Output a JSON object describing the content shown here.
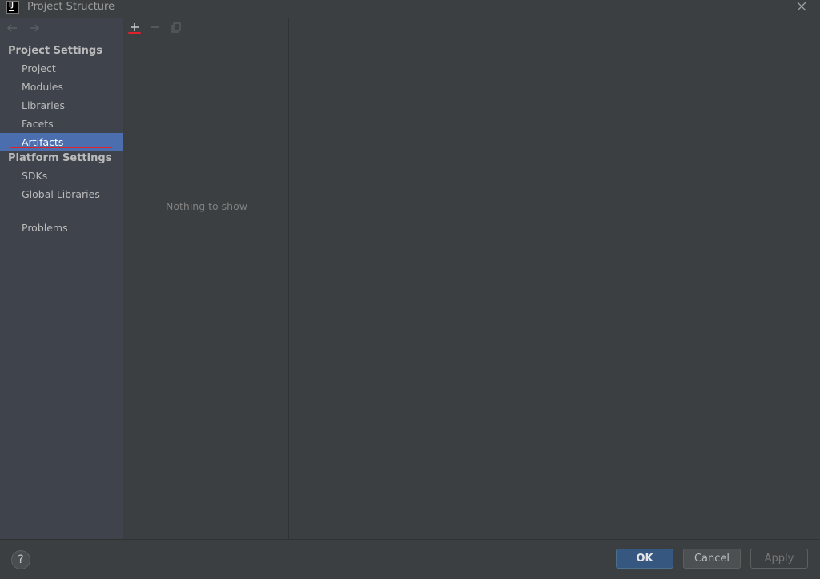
{
  "window": {
    "title": "Project Structure",
    "logo_text": "IJ"
  },
  "sidebar": {
    "project_settings_header": "Project Settings",
    "project_items": [
      "Project",
      "Modules",
      "Libraries",
      "Facets",
      "Artifacts"
    ],
    "platform_settings_header": "Platform Settings",
    "platform_items": [
      "SDKs",
      "Global Libraries"
    ],
    "problems": "Problems",
    "selected": "Artifacts"
  },
  "middle": {
    "empty_text": "Nothing to show"
  },
  "footer": {
    "help": "?",
    "ok": "OK",
    "cancel": "Cancel",
    "apply": "Apply"
  },
  "colors": {
    "selection": "#4b6eaf",
    "annotation": "#e0202a",
    "ok_button": "#365880"
  }
}
